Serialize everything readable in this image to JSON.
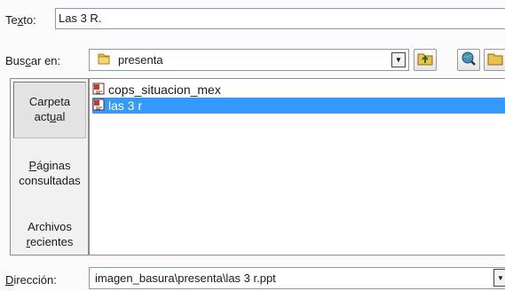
{
  "texto": {
    "label_pre": "Te",
    "label_ul": "x",
    "label_post": "to:",
    "value": "Las 3 R."
  },
  "buscar": {
    "label_pre": "Bus",
    "label_ul": "c",
    "label_post": "ar en:",
    "value": "presenta",
    "folder_icon": "folder-icon",
    "dropdown_glyph": "▼"
  },
  "toolbar": {
    "up_icon": "up-one-level-icon",
    "web_icon": "search-web-icon",
    "newfolder_icon": "new-folder-icon"
  },
  "places": {
    "item1_line1": "Carpeta",
    "item1_line2_pre": "act",
    "item1_line2_ul": "u",
    "item1_line2_post": "al",
    "item2_line1_ul": "P",
    "item2_line1_post": "áginas",
    "item2_line2": "consultadas",
    "item3_line1": "Archivos",
    "item3_line2_ul": "r",
    "item3_line2_post": "ecientes"
  },
  "files": [
    {
      "name": "cops_situacion_mex",
      "icon": "ppt-file-icon",
      "selected": false
    },
    {
      "name": "las 3 r",
      "icon": "ppt-file-icon",
      "selected": true
    }
  ],
  "direccion": {
    "label_ul": "D",
    "label_post": "irección:",
    "value": "imagen_basura\\presenta\\las 3 r.ppt",
    "dropdown_glyph": "▼"
  },
  "colors": {
    "selection": "#3399ff",
    "field_border": "#7f9db9"
  }
}
